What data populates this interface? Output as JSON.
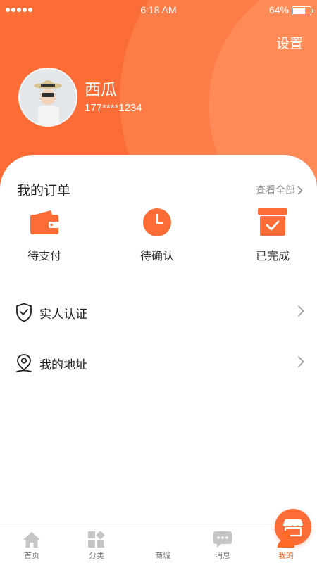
{
  "status_bar": {
    "time": "6:18 AM",
    "battery_pct": "64%",
    "battery_level": 0.64
  },
  "header": {
    "settings_label": "设置"
  },
  "profile": {
    "name": "西瓜",
    "phone": "177****1234"
  },
  "orders": {
    "title": "我的订单",
    "view_all": "查看全部",
    "items": [
      {
        "label": "待支付",
        "icon": "wallet-icon"
      },
      {
        "label": "待确认",
        "icon": "clock-icon"
      },
      {
        "label": "已完成",
        "icon": "box-check-icon"
      }
    ]
  },
  "menu": [
    {
      "label": "实人认证",
      "icon": "shield-check-icon"
    },
    {
      "label": "我的地址",
      "icon": "location-pin-icon"
    }
  ],
  "tabbar": {
    "tabs": [
      {
        "label": "首页",
        "icon": "home-icon"
      },
      {
        "label": "分类",
        "icon": "category-icon"
      },
      {
        "label": "商城",
        "icon": "store-icon"
      },
      {
        "label": "消息",
        "icon": "message-icon"
      },
      {
        "label": "我的",
        "icon": "user-icon"
      }
    ],
    "active_index": 4
  },
  "colors": {
    "accent": "#fb6c37",
    "tab_active": "#ff6a27",
    "tab_inactive": "#c5c5c5"
  }
}
